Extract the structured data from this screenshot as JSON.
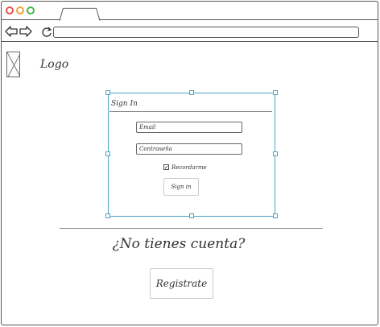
{
  "browser": {
    "back_icon": "arrow-left-icon",
    "forward_icon": "arrow-right-icon",
    "reload_icon": "reload-icon",
    "url": ""
  },
  "header": {
    "logo_image_icon": "image-placeholder-icon",
    "logo_text": "Logo"
  },
  "signin": {
    "title": "Sign In",
    "email_value": "Email",
    "password_value": "Contraseña",
    "remember_label": "Recordarme",
    "remember_checked": true,
    "submit_label": "Sign in"
  },
  "register": {
    "question": "¿No tienes cuenta?",
    "button_label": "Registrate"
  },
  "colors": {
    "close": "#e8524a",
    "minimize": "#f2a33a",
    "maximize": "#4cb54c",
    "selection": "#4aa3c9"
  }
}
